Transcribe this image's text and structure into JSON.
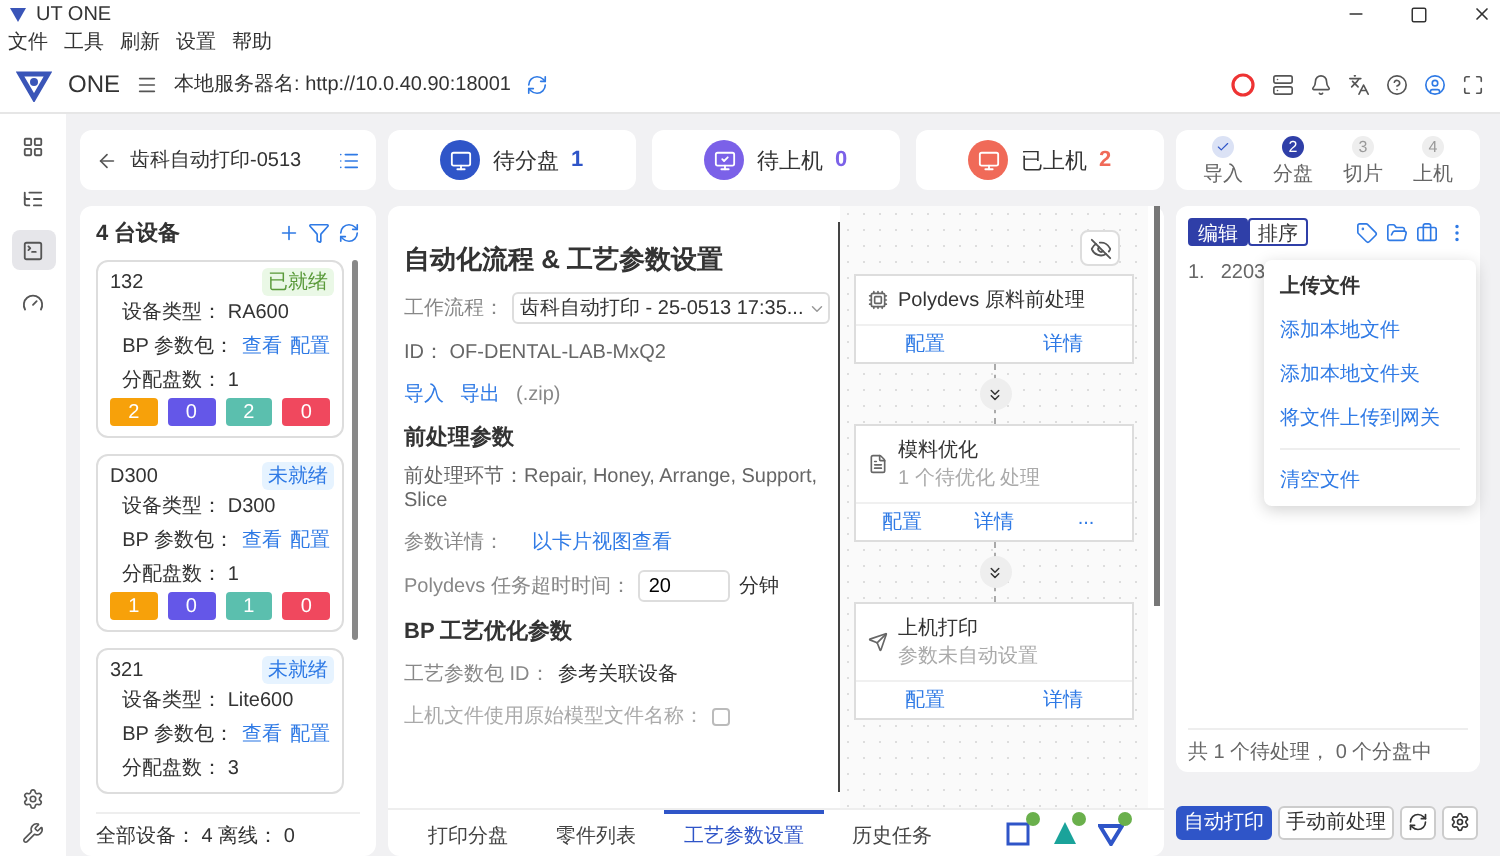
{
  "window": {
    "title": "UT ONE"
  },
  "menu": [
    "文件",
    "工具",
    "刷新",
    "设置",
    "帮助"
  ],
  "header": {
    "brand": "ONE",
    "server": "本地服务器名: http://10.0.40.90:18001"
  },
  "rail": [
    {
      "kind": "printers",
      "selected": false
    },
    {
      "kind": "list",
      "selected": false
    },
    {
      "kind": "terminal",
      "selected": true
    },
    {
      "kind": "gauge",
      "selected": false
    }
  ],
  "project": {
    "title": "齿科自动打印-0513"
  },
  "devices": {
    "title": "4 台设备",
    "footer": "全部设备： 4 离线： 0",
    "items": [
      {
        "name": "132",
        "status": "已就绪",
        "ready": true,
        "type": "设备类型： RA600",
        "param_label": "BP 参数包：",
        "links": [
          "查看",
          "配置"
        ],
        "count": "分配盘数： 1",
        "counts": [
          {
            "value": "2",
            "color": "#f7a10a"
          },
          {
            "value": "0",
            "color": "#6457e8"
          },
          {
            "value": "2",
            "color": "#5bbfae"
          },
          {
            "value": "0",
            "color": "#f0485e"
          }
        ]
      },
      {
        "name": "D300",
        "status": "未就绪",
        "ready": false,
        "type": "设备类型： D300",
        "param_label": "BP 参数包：",
        "links": [
          "查看",
          "配置"
        ],
        "count": "分配盘数： 1",
        "counts": [
          {
            "value": "1",
            "color": "#f7a10a"
          },
          {
            "value": "0",
            "color": "#6457e8"
          },
          {
            "value": "1",
            "color": "#5bbfae"
          },
          {
            "value": "0",
            "color": "#f0485e"
          }
        ]
      },
      {
        "name": "321",
        "status": "未就绪",
        "ready": false,
        "type": "设备类型： Lite600",
        "param_label": "BP 参数包：",
        "links": [
          "查看",
          "配置"
        ],
        "count": "分配盘数： 3"
      }
    ]
  },
  "status_cards": [
    {
      "label": "待分盘",
      "count": "1",
      "color": "#2f55c8"
    },
    {
      "label": "待上机",
      "count": "0",
      "color": "#7b61e8"
    },
    {
      "label": "已上机",
      "count": "2",
      "color": "#f06a58"
    }
  ],
  "settings": {
    "title": "自动化流程 & 工艺参数设置",
    "workflow_label": "工作流程：",
    "workflow_value": "齿科自动打印 - 25-0513 17:35...",
    "id": "ID： OF-DENTAL-LAB-MxQ2",
    "links": [
      "导入",
      "导出"
    ],
    "links_note": "(.zip)",
    "pre_title": "前处理参数",
    "pre_steps_label": "前处理环节：",
    "pre_steps": "Repair, Honey, Arrange, Support, Slice",
    "detail_label": "参数详情：",
    "detail_link": "以卡片视图查看",
    "timeout_label": "Polydevs 任务超时时间：",
    "timeout_value": "20",
    "timeout_unit": "分钟",
    "bp_title": "BP 工艺优化参数",
    "bp_id_label": "工艺参数包 ID：",
    "bp_id_value": "参考关联设备",
    "rename_label": "上机文件使用原始模型文件名称：",
    "rename_checked": false
  },
  "flow": {
    "nodes": [
      {
        "kind": "process",
        "title": "Polydevs 原料前处理",
        "actions": [
          "配置",
          "详情"
        ]
      },
      {
        "kind": "file",
        "title": "模料优化",
        "subtitle": "1 个待优化 处理",
        "actions": [
          "配置",
          "详情",
          "..."
        ]
      },
      {
        "kind": "print",
        "title": "上机打印",
        "subtitle": "参数未自动设置",
        "actions": [
          "配置",
          "详情"
        ]
      }
    ]
  },
  "tabs": [
    {
      "label": "打印分盘",
      "selected": false
    },
    {
      "label": "零件列表",
      "selected": false
    },
    {
      "label": "工艺参数设置",
      "selected": true
    },
    {
      "label": "历史任务",
      "selected": false
    }
  ],
  "steps": [
    {
      "label": "导入",
      "done": true,
      "active": false
    },
    {
      "label": "分盘",
      "number": "2",
      "done": false,
      "active": true
    },
    {
      "label": "切片",
      "number": "3",
      "done": false,
      "active": false
    },
    {
      "label": "上机",
      "number": "4",
      "done": false,
      "active": false
    }
  ],
  "file_panel": {
    "modes": [
      {
        "label": "编辑",
        "selected": true
      },
      {
        "label": "排序",
        "selected": false
      }
    ],
    "files": [
      {
        "index": "1.",
        "name": "2203"
      }
    ],
    "menu": {
      "title": "上传文件",
      "items": [
        "添加本地文件",
        "添加本地文件夹",
        "将文件上传到网关"
      ],
      "danger": "清空文件"
    },
    "footer": "共 1 个待处理， 0 个分盘中"
  },
  "actions": {
    "primary": "自动打印",
    "secondary": "手动前处理"
  }
}
